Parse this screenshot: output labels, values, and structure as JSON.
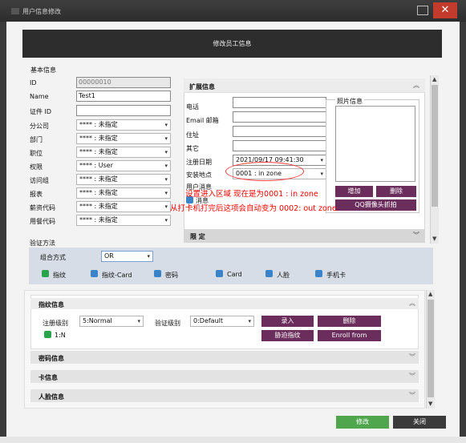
{
  "window": {
    "title": "用户信息修改",
    "close_glyph": "✕"
  },
  "header": {
    "title": "修改员工信息"
  },
  "basic": {
    "section_title": "基本信息",
    "fields": [
      {
        "label": "ID",
        "value": "00000010",
        "kind": "input-ro"
      },
      {
        "label": "Name",
        "value": "Test1",
        "kind": "input"
      },
      {
        "label": "证件 ID",
        "value": "",
        "kind": "input"
      },
      {
        "label": "分公司",
        "value": "**** : 未指定",
        "kind": "select"
      },
      {
        "label": "部门",
        "value": "**** : 未指定",
        "kind": "select"
      },
      {
        "label": "职位",
        "value": "**** : 未指定",
        "kind": "select"
      },
      {
        "label": "权限",
        "value": "**** : User",
        "kind": "select"
      },
      {
        "label": "访问组",
        "value": "**** : 未指定",
        "kind": "select"
      },
      {
        "label": "报表",
        "value": "**** : 未指定",
        "kind": "select"
      },
      {
        "label": "薪资代码",
        "value": "**** : 未指定",
        "kind": "select"
      },
      {
        "label": "用餐代码",
        "value": "**** : 未指定",
        "kind": "select"
      }
    ]
  },
  "extended": {
    "title": "扩展信息",
    "collapse_glyph": "︽",
    "fields": [
      {
        "label": "电话",
        "value": ""
      },
      {
        "label": "Email 邮箱",
        "value": ""
      },
      {
        "label": "住址",
        "value": ""
      },
      {
        "label": "其它",
        "value": ""
      }
    ],
    "reg_date_label": "注册日期",
    "reg_date_value": "2021/09/17 09:41:30",
    "install_label": "安装地点",
    "install_value": "0001 : in zone",
    "message_label_1": "用户消息",
    "message_label_2": "消息",
    "photo": {
      "title": "照片信息",
      "add": "增加",
      "delete": "删除",
      "camera": "QQ摄像头抓拍"
    }
  },
  "limit": {
    "title": "限 定",
    "expand_glyph": "︾"
  },
  "verify": {
    "title": "验证方法",
    "combo_label": "组合方式",
    "combo_value": "OR",
    "options": [
      {
        "label": "指纹",
        "checked": true
      },
      {
        "label": "指纹-Card",
        "checked": false
      },
      {
        "label": "密码",
        "checked": false
      },
      {
        "label": "Card",
        "checked": false
      },
      {
        "label": "人脸",
        "checked": false
      },
      {
        "label": "手机卡",
        "checked": false
      }
    ]
  },
  "fingerprint": {
    "title": "指纹信息",
    "reg_level_label": "注册级别",
    "reg_level_value": "5:Normal",
    "verify_level_label": "验证级别",
    "verify_level_value": "0:Default",
    "enroll": "录入",
    "delete": "删除",
    "duress": "胁迫指纹",
    "enroll_terminal": "Enroll from terminal",
    "item": "1:N"
  },
  "sections": [
    "密码信息",
    "卡信息",
    "人脸信息"
  ],
  "annotations": {
    "line1": "设置进入区域 现在是为0001 : in zone",
    "line2": "从打卡机打完后这项会自动变为 0002: out zone."
  },
  "footer": {
    "modify": "修改",
    "close": "关闭"
  },
  "colors": {
    "accent_dark": "#6b2d5c",
    "modify_green": "#4fa64c",
    "close_dark": "#3b3b3b",
    "annotation_red": "#ff0000"
  }
}
